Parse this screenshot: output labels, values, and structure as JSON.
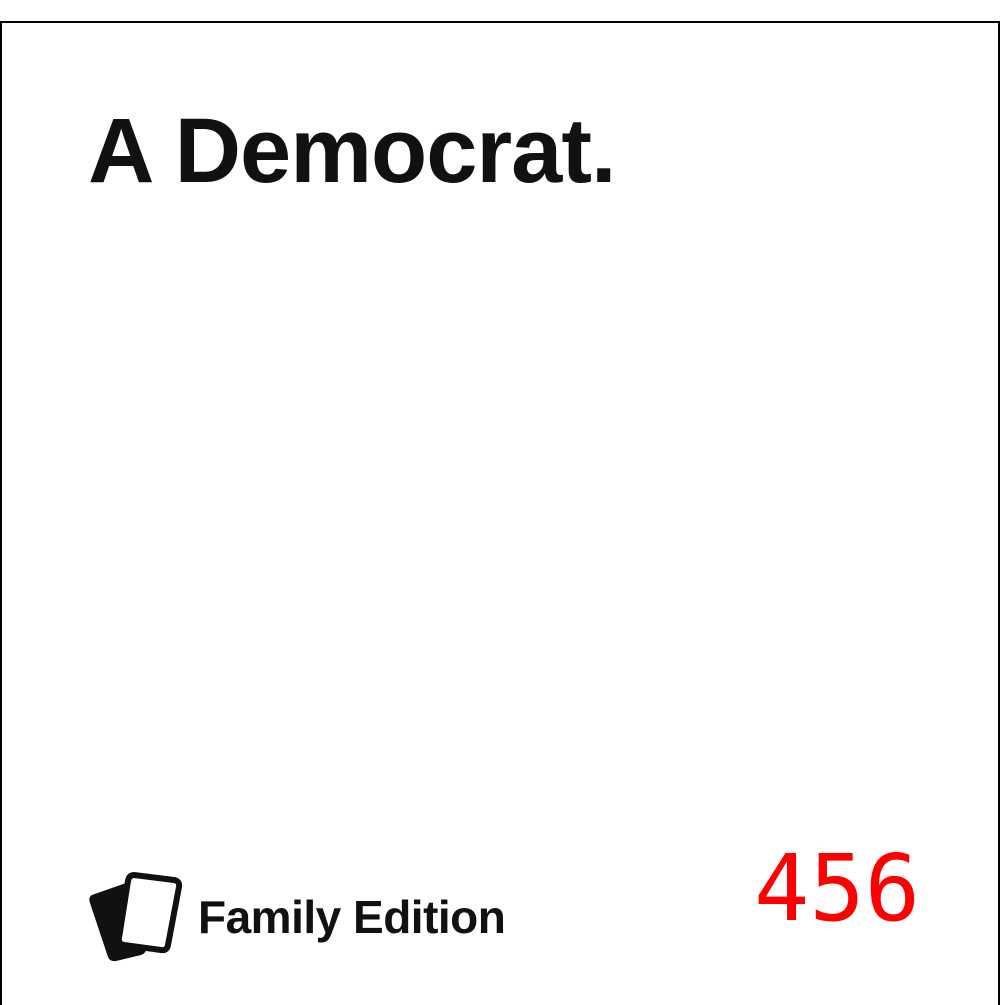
{
  "card": {
    "text": "A Democrat.",
    "brand_label": "Family Edition",
    "number": "456"
  },
  "icons": {
    "logo": "stacked-cards-icon"
  },
  "colors": {
    "text": "#111111",
    "number": "#ff0000",
    "background": "#ffffff",
    "border": "#000000"
  }
}
